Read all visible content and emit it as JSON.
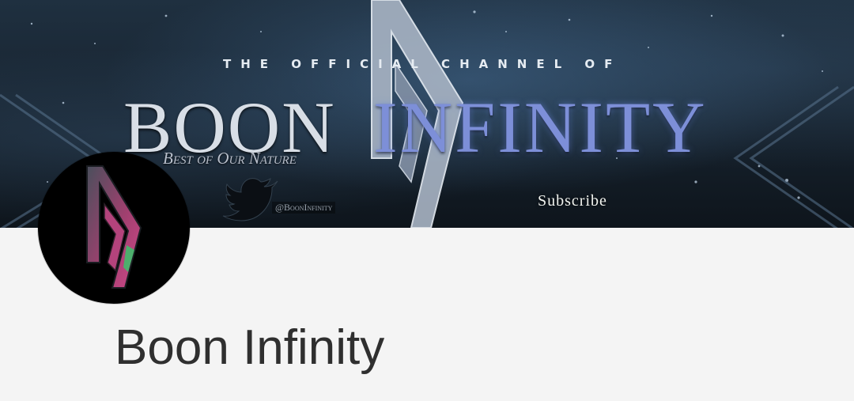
{
  "banner": {
    "tagline": "THE OFFICIAL CHANNEL OF",
    "title_word_1": "BOON",
    "title_word_2": "INFINITY",
    "motto": "Best of Our Nature",
    "twitter_handle": "@BoonInfinity",
    "subscribe_label": "Subscribe",
    "icons": [
      "boon-infinity-logo-icon",
      "twitter-bird-icon"
    ]
  },
  "channel": {
    "name": "Boon Infinity",
    "avatar_icon": "boon-infinity-logo-icon"
  },
  "colors": {
    "page_background": "#f4f4f4",
    "banner_dark": "#17232f",
    "title_accent": "#7d8fd8",
    "channel_name_text": "#2f2f2f",
    "avatar_background": "#000000",
    "avatar_logo_pink": "#c0407a",
    "avatar_logo_green": "#39c26a"
  }
}
